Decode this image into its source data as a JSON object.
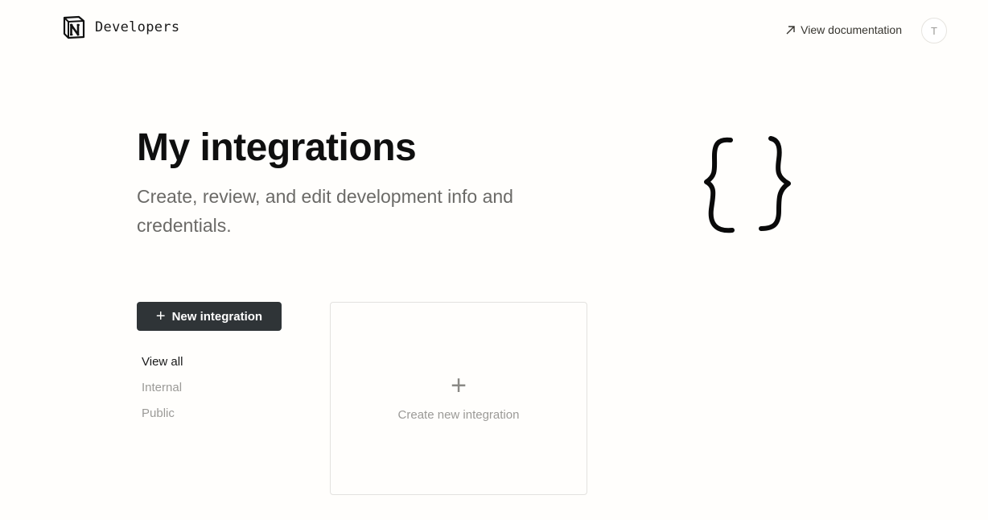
{
  "header": {
    "brand_name": "Developers",
    "logo_icon": "notion-logo-icon",
    "docs_link_label": "View documentation",
    "docs_link_icon": "arrow-up-right-icon",
    "avatar_initial": "T"
  },
  "hero": {
    "title": "My integrations",
    "subtitle": "Create, review, and edit development info and credentials.",
    "illustration_icon": "curly-braces-icon"
  },
  "actions": {
    "new_integration_label": "New integration",
    "new_integration_icon": "plus-icon"
  },
  "filters": {
    "items": [
      {
        "label": "View all",
        "active": true
      },
      {
        "label": "Internal",
        "active": false
      },
      {
        "label": "Public",
        "active": false
      }
    ]
  },
  "create_card": {
    "icon": "plus-icon",
    "label": "Create new integration"
  },
  "colors": {
    "background": "#fffefc",
    "button_bg": "#2f3437",
    "muted_text": "#9b9a97",
    "subtitle_text": "#6b6a67"
  }
}
